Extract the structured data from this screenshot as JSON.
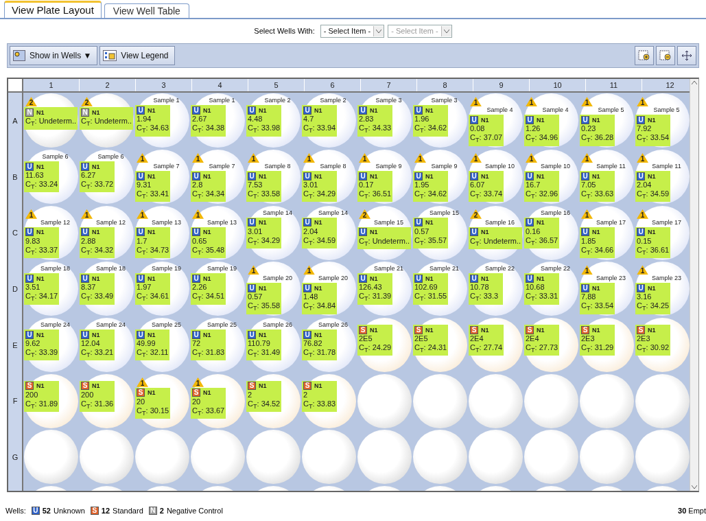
{
  "tabs": [
    {
      "label": "View Plate Layout",
      "selected": true
    },
    {
      "label": "View Well Table",
      "selected": false
    }
  ],
  "select_wells": {
    "label": "Select Wells With:",
    "selects": [
      {
        "value": "- Select Item -",
        "disabled": false
      },
      {
        "value": "- Select Item -",
        "disabled": true
      }
    ]
  },
  "toolbar": {
    "show_in_wells": "Show in Wells ▼",
    "view_legend": "View Legend"
  },
  "plate": {
    "columns": [
      "1",
      "2",
      "3",
      "4",
      "5",
      "6",
      "7",
      "8",
      "9",
      "10",
      "11",
      "12"
    ],
    "rows": [
      {
        "label": "A",
        "wells": [
          {
            "kind": "negative",
            "flag": "2",
            "letter": "N",
            "target": "N1",
            "ct": "C$_{T}$: Undeterm.."
          },
          {
            "kind": "negative",
            "flag": "2",
            "letter": "N",
            "target": "N1",
            "ct": "C$_{T}$: Undeterm.."
          },
          {
            "kind": "unknown",
            "sample": "Sample 1",
            "letter": "U",
            "target": "N1",
            "quantity": "1.94",
            "ct": "C$_{T}$: 34.63"
          },
          {
            "kind": "unknown",
            "sample": "Sample 1",
            "letter": "U",
            "target": "N1",
            "quantity": "2.67",
            "ct": "C$_{T}$: 34.38"
          },
          {
            "kind": "unknown",
            "sample": "Sample 2",
            "letter": "U",
            "target": "N1",
            "quantity": "4.48",
            "ct": "C$_{T}$: 33.98"
          },
          {
            "kind": "unknown",
            "sample": "Sample 2",
            "letter": "U",
            "target": "N1",
            "quantity": "4.7",
            "ct": "C$_{T}$: 33.94"
          },
          {
            "kind": "unknown",
            "sample": "Sample 3",
            "letter": "U",
            "target": "N1",
            "quantity": "2.83",
            "ct": "C$_{T}$: 34.33"
          },
          {
            "kind": "unknown",
            "sample": "Sample 3",
            "letter": "U",
            "target": "N1",
            "quantity": "1.96",
            "ct": "C$_{T}$: 34.62"
          },
          {
            "kind": "unknown",
            "flag": "1",
            "sample": "Sample 4",
            "letter": "U",
            "target": "N1",
            "quantity": "0.08",
            "ct": "C$_{T}$: 37.07"
          },
          {
            "kind": "unknown",
            "flag": "1",
            "sample": "Sample 4",
            "letter": "U",
            "target": "N1",
            "quantity": "1.26",
            "ct": "C$_{T}$: 34.96"
          },
          {
            "kind": "unknown",
            "flag": "1",
            "sample": "Sample 5",
            "letter": "U",
            "target": "N1",
            "quantity": "0.23",
            "ct": "C$_{T}$: 36.28"
          },
          {
            "kind": "unknown",
            "flag": "1",
            "sample": "Sample 5",
            "letter": "U",
            "target": "N1",
            "quantity": "7.92",
            "ct": "C$_{T}$: 33.54"
          }
        ]
      },
      {
        "label": "B",
        "wells": [
          {
            "kind": "unknown",
            "sample": "Sample 6",
            "letter": "U",
            "target": "N1",
            "quantity": "11.63",
            "ct": "C$_{T}$: 33.24"
          },
          {
            "kind": "unknown",
            "sample": "Sample 6",
            "letter": "U",
            "target": "N1",
            "quantity": "6.27",
            "ct": "C$_{T}$: 33.72"
          },
          {
            "kind": "unknown",
            "flag": "1",
            "sample": "Sample 7",
            "letter": "U",
            "target": "N1",
            "quantity": "9.31",
            "ct": "C$_{T}$: 33.41"
          },
          {
            "kind": "unknown",
            "flag": "1",
            "sample": "Sample 7",
            "letter": "U",
            "target": "N1",
            "quantity": "2.8",
            "ct": "C$_{T}$: 34.34"
          },
          {
            "kind": "unknown",
            "flag": "1",
            "sample": "Sample 8",
            "letter": "U",
            "target": "N1",
            "quantity": "7.53",
            "ct": "C$_{T}$: 33.58"
          },
          {
            "kind": "unknown",
            "flag": "1",
            "sample": "Sample 8",
            "letter": "U",
            "target": "N1",
            "quantity": "3.01",
            "ct": "C$_{T}$: 34.29"
          },
          {
            "kind": "unknown",
            "flag": "1",
            "sample": "Sample 9",
            "letter": "U",
            "target": "N1",
            "quantity": "0.17",
            "ct": "C$_{T}$: 36.51"
          },
          {
            "kind": "unknown",
            "flag": "1",
            "sample": "Sample 9",
            "letter": "U",
            "target": "N1",
            "quantity": "1.95",
            "ct": "C$_{T}$: 34.62"
          },
          {
            "kind": "unknown",
            "flag": "1",
            "sample": "Sample 10",
            "letter": "U",
            "target": "N1",
            "quantity": "6.07",
            "ct": "C$_{T}$: 33.74"
          },
          {
            "kind": "unknown",
            "flag": "1",
            "sample": "Sample 10",
            "letter": "U",
            "target": "N1",
            "quantity": "16.7",
            "ct": "C$_{T}$: 32.96"
          },
          {
            "kind": "unknown",
            "flag": "1",
            "sample": "Sample 11",
            "letter": "U",
            "target": "N1",
            "quantity": "7.05",
            "ct": "C$_{T}$: 33.63"
          },
          {
            "kind": "unknown",
            "flag": "1",
            "sample": "Sample 11",
            "letter": "U",
            "target": "N1",
            "quantity": "2.04",
            "ct": "C$_{T}$: 34.59"
          }
        ]
      },
      {
        "label": "C",
        "wells": [
          {
            "kind": "unknown",
            "flag": "1",
            "sample": "Sample 12",
            "letter": "U",
            "target": "N1",
            "quantity": "9.83",
            "ct": "C$_{T}$: 33.37"
          },
          {
            "kind": "unknown",
            "flag": "1",
            "sample": "Sample 12",
            "letter": "U",
            "target": "N1",
            "quantity": "2.88",
            "ct": "C$_{T}$: 34.32"
          },
          {
            "kind": "unknown",
            "flag": "1",
            "sample": "Sample 13",
            "letter": "U",
            "target": "N1",
            "quantity": "1.7",
            "ct": "C$_{T}$: 34.73"
          },
          {
            "kind": "unknown",
            "flag": "1",
            "sample": "Sample 13",
            "letter": "U",
            "target": "N1",
            "quantity": "0.65",
            "ct": "C$_{T}$: 35.48"
          },
          {
            "kind": "unknown",
            "sample": "Sample 14",
            "letter": "U",
            "target": "N1",
            "quantity": "3.01",
            "ct": "C$_{T}$: 34.29"
          },
          {
            "kind": "unknown",
            "sample": "Sample 14",
            "letter": "U",
            "target": "N1",
            "quantity": "2.04",
            "ct": "C$_{T}$: 34.59"
          },
          {
            "kind": "unknown",
            "flag": "2",
            "sample": "Sample 15",
            "letter": "U",
            "target": "N1",
            "ct": "C$_{T}$: Undeterm.."
          },
          {
            "kind": "unknown",
            "sample": "Sample 15",
            "letter": "U",
            "target": "N1",
            "quantity": "0.57",
            "ct": "C$_{T}$: 35.57"
          },
          {
            "kind": "unknown",
            "flag": "2",
            "sample": "Sample 16",
            "letter": "U",
            "target": "N1",
            "ct": "C$_{T}$: Undeterm.."
          },
          {
            "kind": "unknown",
            "sample": "Sample 16",
            "letter": "U",
            "target": "N1",
            "quantity": "0.16",
            "ct": "C$_{T}$: 36.57"
          },
          {
            "kind": "unknown",
            "flag": "1",
            "sample": "Sample 17",
            "letter": "U",
            "target": "N1",
            "quantity": "1.85",
            "ct": "C$_{T}$: 34.66"
          },
          {
            "kind": "unknown",
            "flag": "1",
            "sample": "Sample 17",
            "letter": "U",
            "target": "N1",
            "quantity": "0.15",
            "ct": "C$_{T}$: 36.61"
          }
        ]
      },
      {
        "label": "D",
        "wells": [
          {
            "kind": "unknown",
            "sample": "Sample 18",
            "letter": "U",
            "target": "N1",
            "quantity": "3.51",
            "ct": "C$_{T}$: 34.17"
          },
          {
            "kind": "unknown",
            "sample": "Sample 18",
            "letter": "U",
            "target": "N1",
            "quantity": "8.37",
            "ct": "C$_{T}$: 33.49"
          },
          {
            "kind": "unknown",
            "sample": "Sample 19",
            "letter": "U",
            "target": "N1",
            "quantity": "1.97",
            "ct": "C$_{T}$: 34.61"
          },
          {
            "kind": "unknown",
            "sample": "Sample 19",
            "letter": "U",
            "target": "N1",
            "quantity": "2.26",
            "ct": "C$_{T}$: 34.51"
          },
          {
            "kind": "unknown",
            "flag": "1",
            "sample": "Sample 20",
            "letter": "U",
            "target": "N1",
            "quantity": "0.57",
            "ct": "C$_{T}$: 35.58"
          },
          {
            "kind": "unknown",
            "flag": "1",
            "sample": "Sample 20",
            "letter": "U",
            "target": "N1",
            "quantity": "1.48",
            "ct": "C$_{T}$: 34.84"
          },
          {
            "kind": "unknown",
            "sample": "Sample 21",
            "letter": "U",
            "target": "N1",
            "quantity": "126.43",
            "ct": "C$_{T}$: 31.39"
          },
          {
            "kind": "unknown",
            "sample": "Sample 21",
            "letter": "U",
            "target": "N1",
            "quantity": "102.69",
            "ct": "C$_{T}$: 31.55"
          },
          {
            "kind": "unknown",
            "sample": "Sample 22",
            "letter": "U",
            "target": "N1",
            "quantity": "10.78",
            "ct": "C$_{T}$: 33.3"
          },
          {
            "kind": "unknown",
            "sample": "Sample 22",
            "letter": "U",
            "target": "N1",
            "quantity": "10.68",
            "ct": "C$_{T}$: 33.31"
          },
          {
            "kind": "unknown",
            "flag": "1",
            "sample": "Sample 23",
            "letter": "U",
            "target": "N1",
            "quantity": "7.88",
            "ct": "C$_{T}$: 33.54"
          },
          {
            "kind": "unknown",
            "flag": "1",
            "sample": "Sample 23",
            "letter": "U",
            "target": "N1",
            "quantity": "3.16",
            "ct": "C$_{T}$: 34.25"
          }
        ]
      },
      {
        "label": "E",
        "wells": [
          {
            "kind": "unknown",
            "sample": "Sample 24",
            "letter": "U",
            "target": "N1",
            "quantity": "9.62",
            "ct": "C$_{T}$: 33.39"
          },
          {
            "kind": "unknown",
            "sample": "Sample 24",
            "letter": "U",
            "target": "N1",
            "quantity": "12.04",
            "ct": "C$_{T}$: 33.21"
          },
          {
            "kind": "unknown",
            "sample": "Sample 25",
            "letter": "U",
            "target": "N1",
            "quantity": "49.99",
            "ct": "C$_{T}$: 32.11"
          },
          {
            "kind": "unknown",
            "sample": "Sample 25",
            "letter": "U",
            "target": "N1",
            "quantity": "72",
            "ct": "C$_{T}$: 31.83"
          },
          {
            "kind": "unknown",
            "sample": "Sample 26",
            "letter": "U",
            "target": "N1",
            "quantity": "110.79",
            "ct": "C$_{T}$: 31.49"
          },
          {
            "kind": "unknown",
            "sample": "Sample 26",
            "letter": "U",
            "target": "N1",
            "quantity": "76.82",
            "ct": "C$_{T}$: 31.78"
          },
          {
            "kind": "standard",
            "letter": "S",
            "target": "N1",
            "quantity": "2E5",
            "ct": "C$_{T}$: 24.29"
          },
          {
            "kind": "standard",
            "letter": "S",
            "target": "N1",
            "quantity": "2E5",
            "ct": "C$_{T}$: 24.31"
          },
          {
            "kind": "standard",
            "letter": "S",
            "target": "N1",
            "quantity": "2E4",
            "ct": "C$_{T}$: 27.74"
          },
          {
            "kind": "standard",
            "letter": "S",
            "target": "N1",
            "quantity": "2E4",
            "ct": "C$_{T}$: 27.73"
          },
          {
            "kind": "standard",
            "letter": "S",
            "target": "N1",
            "quantity": "2E3",
            "ct": "C$_{T}$: 31.29"
          },
          {
            "kind": "standard",
            "letter": "S",
            "target": "N1",
            "quantity": "2E3",
            "ct": "C$_{T}$: 30.92"
          }
        ]
      },
      {
        "label": "F",
        "wells": [
          {
            "kind": "standard",
            "letter": "S",
            "target": "N1",
            "quantity": "200",
            "ct": "C$_{T}$: 31.89"
          },
          {
            "kind": "standard",
            "letter": "S",
            "target": "N1",
            "quantity": "200",
            "ct": "C$_{T}$: 31.36"
          },
          {
            "kind": "standard",
            "flag": "1",
            "letter": "S",
            "target": "N1",
            "quantity": "20",
            "ct": "C$_{T}$: 30.15"
          },
          {
            "kind": "standard",
            "flag": "1",
            "letter": "S",
            "target": "N1",
            "quantity": "20",
            "ct": "C$_{T}$: 33.67"
          },
          {
            "kind": "standard",
            "letter": "S",
            "target": "N1",
            "quantity": "2",
            "ct": "C$_{T}$: 34.52"
          },
          {
            "kind": "standard",
            "letter": "S",
            "target": "N1",
            "quantity": "2",
            "ct": "C$_{T}$: 33.83"
          },
          {
            "kind": "empty"
          },
          {
            "kind": "empty"
          },
          {
            "kind": "empty"
          },
          {
            "kind": "empty"
          },
          {
            "kind": "empty"
          },
          {
            "kind": "empty"
          }
        ]
      },
      {
        "label": "G",
        "wells": [
          {
            "kind": "empty"
          },
          {
            "kind": "empty"
          },
          {
            "kind": "empty"
          },
          {
            "kind": "empty"
          },
          {
            "kind": "empty"
          },
          {
            "kind": "empty"
          },
          {
            "kind": "empty"
          },
          {
            "kind": "empty"
          },
          {
            "kind": "empty"
          },
          {
            "kind": "empty"
          },
          {
            "kind": "empty"
          },
          {
            "kind": "empty"
          }
        ]
      },
      {
        "wells": [
          {
            "kind": "empty"
          },
          {
            "kind": "empty"
          },
          {
            "kind": "empty"
          },
          {
            "kind": "empty"
          },
          {
            "kind": "empty"
          },
          {
            "kind": "empty"
          },
          {
            "kind": "empty"
          },
          {
            "kind": "empty"
          },
          {
            "kind": "empty"
          },
          {
            "kind": "empty"
          },
          {
            "kind": "empty"
          },
          {
            "kind": "empty"
          }
        ]
      }
    ]
  },
  "footer": {
    "label": "Wells:",
    "legend": [
      {
        "kind": "unknown",
        "letter": "U",
        "count": "52",
        "name": "Unknown"
      },
      {
        "kind": "standard",
        "letter": "S",
        "count": "12",
        "name": "Standard"
      },
      {
        "kind": "negative",
        "letter": "N",
        "count": "2",
        "name": "Negative Control"
      }
    ],
    "empty": "**30** Empt"
  }
}
